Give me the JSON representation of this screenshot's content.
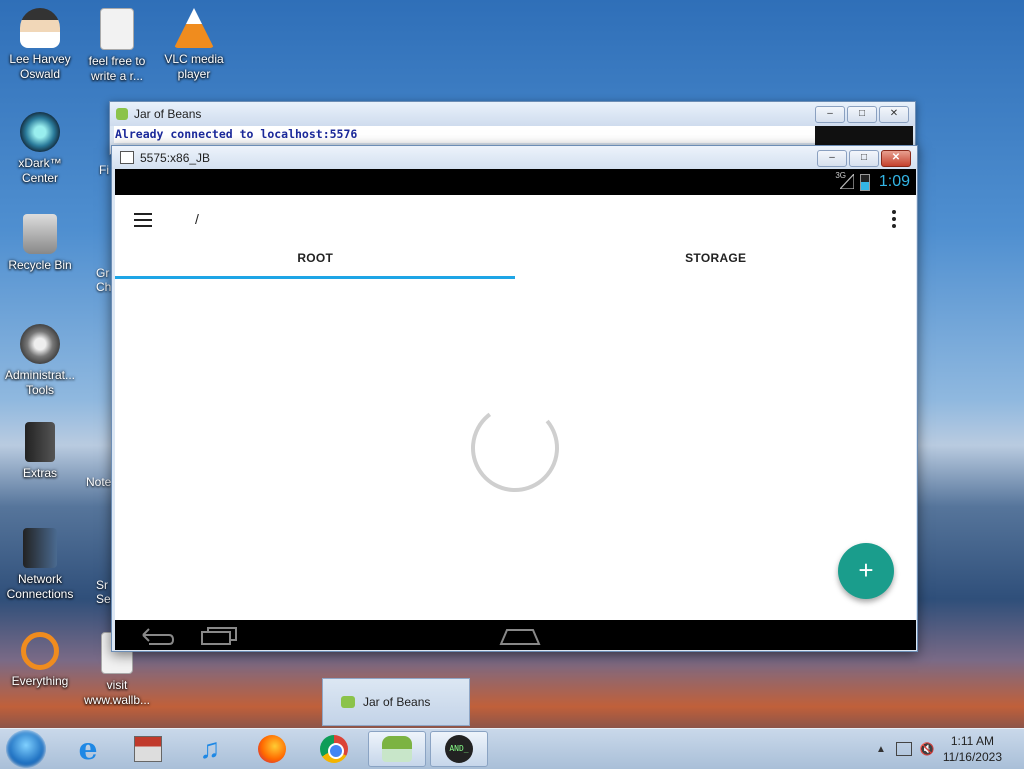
{
  "desktop": {
    "icons": [
      {
        "label": "Lee Harvey\nOswald"
      },
      {
        "label": "feel free to\nwrite a r..."
      },
      {
        "label": "VLC media\nplayer"
      },
      {
        "label": "xDark™\nCenter"
      },
      {
        "label": "Recycle Bin"
      },
      {
        "label": "Administrat...\nTools"
      },
      {
        "label": "Extras"
      },
      {
        "label": "Network\nConnections"
      },
      {
        "label": "Everything"
      },
      {
        "label": "visit\nwww.wallb..."
      }
    ],
    "peeks": [
      "Fi",
      "Gr\nCh",
      "Note",
      "Sr\nSe"
    ]
  },
  "jar_window": {
    "title": "Jar of Beans",
    "console_text": "Already connected to localhost:5576"
  },
  "emulator_window": {
    "title": "5575:x86_JB",
    "statusbar": {
      "network": "3G",
      "time": "1:09"
    },
    "toolbar": {
      "path": "/"
    },
    "tabs": [
      {
        "label": "ROOT",
        "selected": true
      },
      {
        "label": "STORAGE",
        "selected": false
      }
    ],
    "fab_icon": "+",
    "colors": {
      "accent": "#1ea5e6",
      "fab": "#1a9d8c"
    }
  },
  "taskbar": {
    "popup_label": "Jar of Beans",
    "clock_time": "1:11 AM",
    "clock_date": "11/16/2023",
    "apps": [
      "internet-explorer",
      "store",
      "itunes",
      "firefox",
      "chrome",
      "jar-of-beans",
      "terminal"
    ]
  }
}
